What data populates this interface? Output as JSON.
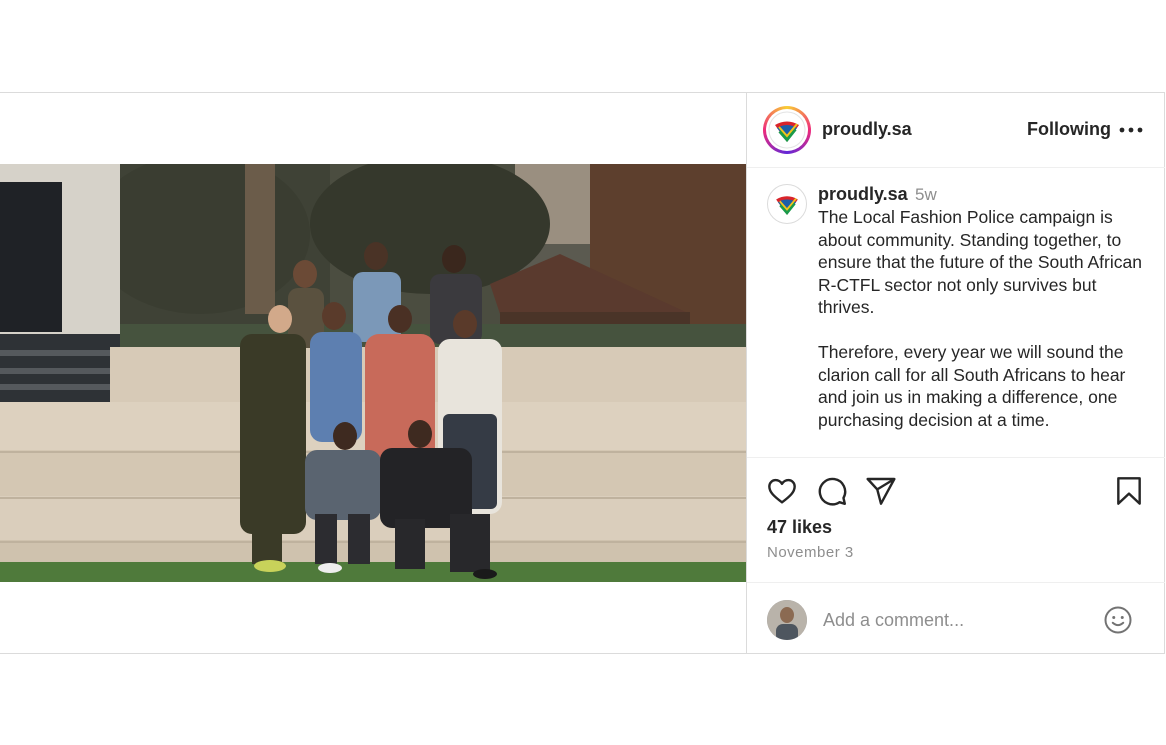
{
  "post": {
    "username": "proudly.sa",
    "follow_status": "Following",
    "more_icon": "more-horizontal-icon",
    "photo_alt": "Group photo"
  },
  "caption": {
    "username": "proudly.sa",
    "time_ago": "5w",
    "text": "The Local Fashion Police campaign is about community. Standing together, to ensure that the future of the South African R-CTFL sector not only survives but thrives.\n\nTherefore, every year we will sound the clarion call for all South Africans to hear and join us in making a difference, one purchasing decision at a time."
  },
  "actions": {
    "icons": [
      "heart-icon",
      "comment-icon",
      "share-icon",
      "bookmark-icon"
    ],
    "likes": "47 likes",
    "date": "November 3"
  },
  "comment": {
    "placeholder": "Add a comment...",
    "emoji_icon": "emoji-icon"
  },
  "colors": {
    "text": "#262626",
    "muted": "#8e8e8e",
    "border": "#dbdbdb",
    "ring_start": "#f9ce34",
    "ring_mid": "#ee2a7b",
    "ring_end": "#6228d7"
  }
}
